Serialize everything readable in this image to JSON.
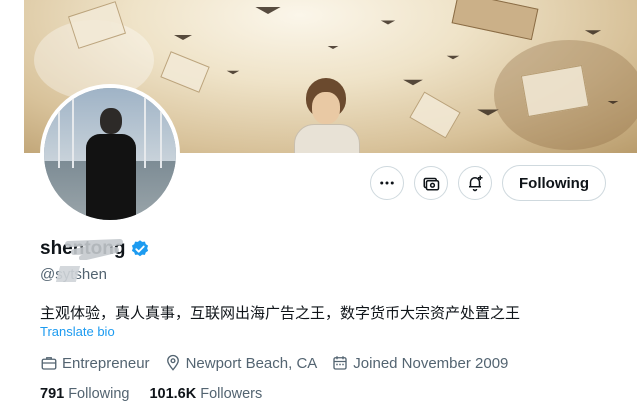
{
  "profile": {
    "name": "shentong",
    "handle": "@sytshen",
    "bio": "主观体验，真人真事，互联网出海广告之王，数字货币大宗资产处置之王",
    "translate_label": "Translate bio",
    "category": "Entrepreneur",
    "location": "Newport Beach, CA",
    "joined": "Joined November 2009",
    "following_count": "791",
    "following_label": "Following",
    "followers_count": "101.6K",
    "followers_label": "Followers"
  },
  "actions": {
    "follow_button": "Following",
    "more_icon": "more-icon",
    "subscribe_icon": "subscribe-icon",
    "notify_icon": "bell-plus-icon"
  },
  "colors": {
    "accent": "#1d9bf0",
    "text_primary": "#0f1419",
    "text_secondary": "#536471",
    "border": "#cfd9de"
  }
}
